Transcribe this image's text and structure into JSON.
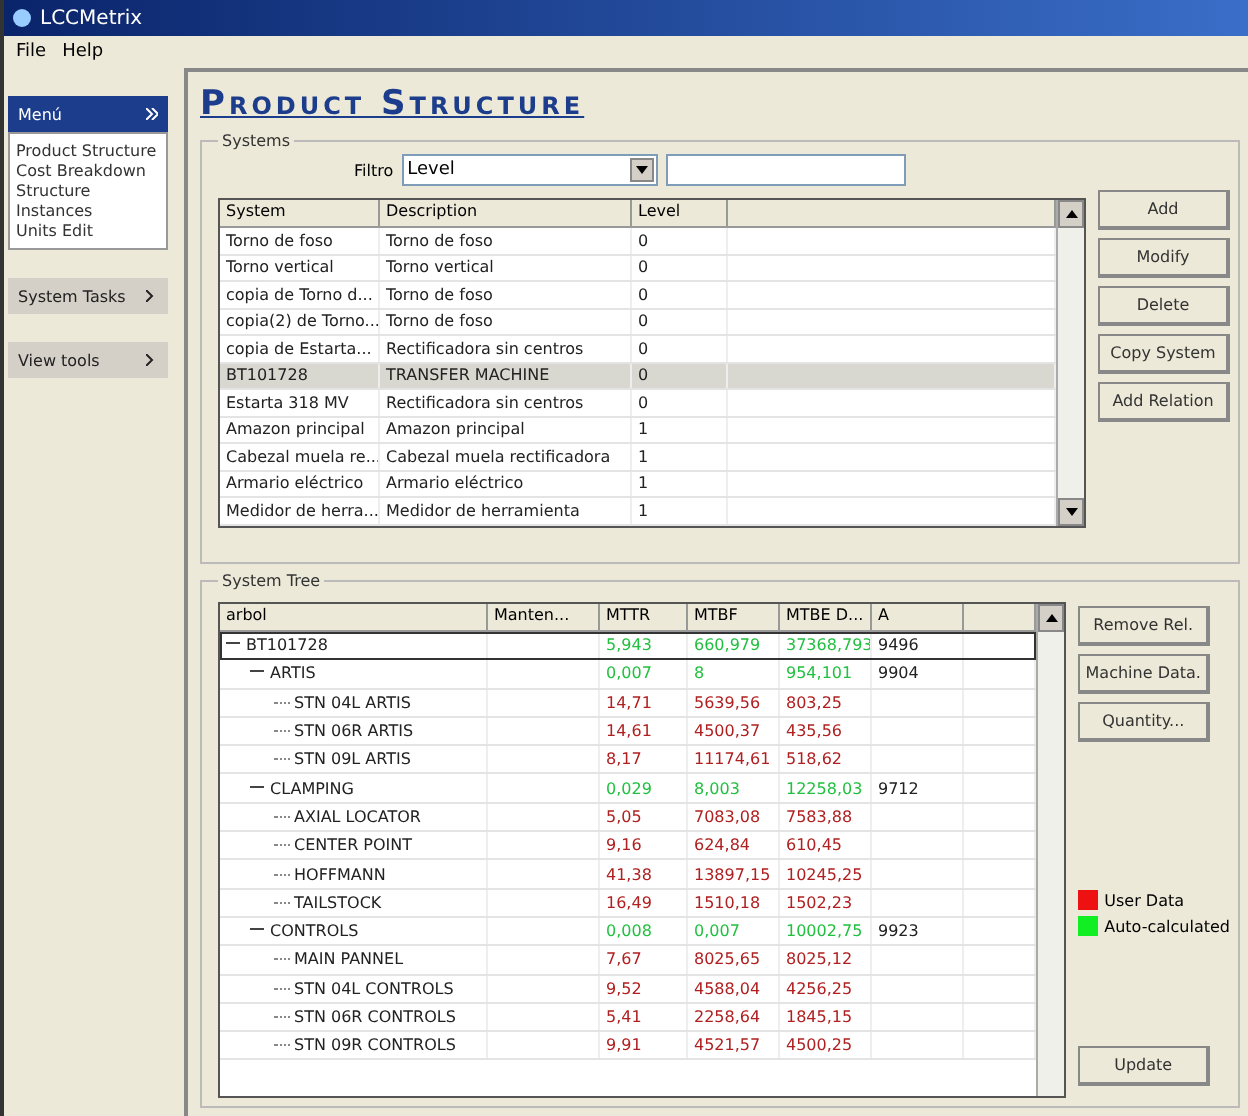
{
  "window": {
    "title": "LCCMetrix"
  },
  "menu": [
    "File",
    "Help"
  ],
  "sidebar": {
    "panels": [
      {
        "title": "Menú",
        "expanded": true,
        "items": [
          "Product Structure",
          "Cost Breakdown",
          "Structure",
          "Instances",
          "Units Edit"
        ]
      },
      {
        "title": "System Tasks",
        "expanded": false
      },
      {
        "title": "View tools",
        "expanded": false
      }
    ]
  },
  "page_title": "Product Structure",
  "systems": {
    "label": "Systems",
    "filter_label": "Filtro",
    "filter_value": "Level",
    "columns": [
      "System",
      "Description",
      "Level"
    ],
    "rows": [
      {
        "cells": [
          "Torno de foso",
          "Torno de foso",
          "0"
        ],
        "selected": false
      },
      {
        "cells": [
          "Torno vertical",
          "Torno vertical",
          "0"
        ],
        "selected": false
      },
      {
        "cells": [
          "copia de Torno d...",
          "Torno de foso",
          "0"
        ],
        "selected": false
      },
      {
        "cells": [
          "copia(2) de Torno...",
          "Torno de foso",
          "0"
        ],
        "selected": false
      },
      {
        "cells": [
          "copia de Estarta...",
          "Rectificadora sin centros",
          "0"
        ],
        "selected": false
      },
      {
        "cells": [
          "BT101728",
          "TRANSFER MACHINE",
          "0"
        ],
        "selected": true
      },
      {
        "cells": [
          "Estarta 318 MV",
          "Rectificadora sin centros",
          "0"
        ],
        "selected": false
      },
      {
        "cells": [
          "Amazon principal",
          "Amazon principal",
          "1"
        ],
        "selected": false
      },
      {
        "cells": [
          "Cabezal muela re...",
          "Cabezal muela rectificadora",
          "1"
        ],
        "selected": false
      },
      {
        "cells": [
          "Armario eléctrico",
          "Armario eléctrico",
          "1"
        ],
        "selected": false
      },
      {
        "cells": [
          "Medidor de herra...",
          "Medidor de herramienta",
          "1"
        ],
        "selected": false
      }
    ],
    "buttons": [
      "Add",
      "Modify",
      "Delete",
      "Copy System",
      "Add Relation"
    ]
  },
  "tree": {
    "label": "System Tree",
    "columns": [
      "arbol",
      "Manten...",
      "MTTR",
      "MTBF",
      "MTBE D...",
      "A"
    ],
    "nodes": [
      {
        "label": "BT101728",
        "values": [
          "5,943",
          "660,979",
          "37368,793"
        ],
        "a": "9496",
        "color": "#22c040",
        "selected": true,
        "expanded": true,
        "children": [
          {
            "label": "ARTIS",
            "values": [
              "0,007",
              "8",
              "954,101"
            ],
            "a": "9904",
            "color": "#22c040",
            "selected": false,
            "expanded": true,
            "children": [
              {
                "label": "STN 04L ARTIS",
                "values": [
                  "14,71",
                  "5639,56",
                  "803,25"
                ],
                "color": "#b02020",
                "selected": false
              },
              {
                "label": "STN 06R ARTIS",
                "values": [
                  "14,61",
                  "4500,37",
                  "435,56"
                ],
                "color": "#b02020",
                "selected": false
              },
              {
                "label": "STN 09L ARTIS",
                "values": [
                  "8,17",
                  "11174,61",
                  "518,62"
                ],
                "color": "#b02020",
                "selected": false
              }
            ]
          },
          {
            "label": "CLAMPING",
            "values": [
              "0,029",
              "8,003",
              "12258,03"
            ],
            "a": "9712",
            "color": "#22c040",
            "selected": false,
            "expanded": true,
            "children": [
              {
                "label": "AXIAL LOCATOR",
                "values": [
                  "5,05",
                  "7083,08",
                  "7583,88"
                ],
                "color": "#b02020",
                "selected": false
              },
              {
                "label": "CENTER POINT",
                "values": [
                  "9,16",
                  "624,84",
                  "610,45"
                ],
                "color": "#b02020",
                "selected": false
              },
              {
                "label": "HOFFMANN",
                "values": [
                  "41,38",
                  "13897,15",
                  "10245,25"
                ],
                "color": "#b02020",
                "selected": false
              },
              {
                "label": "TAILSTOCK",
                "values": [
                  "16,49",
                  "1510,18",
                  "1502,23"
                ],
                "color": "#b02020",
                "selected": false
              }
            ]
          },
          {
            "label": "CONTROLS",
            "values": [
              "0,008",
              "0,007",
              "10002,75"
            ],
            "a": "9923",
            "color": "#22c040",
            "selected": false,
            "expanded": true,
            "children": [
              {
                "label": "MAIN PANNEL",
                "values": [
                  "7,67",
                  "8025,65",
                  "8025,12"
                ],
                "color": "#b02020",
                "selected": false
              },
              {
                "label": "STN 04L CONTROLS",
                "values": [
                  "9,52",
                  "4588,04",
                  "4256,25"
                ],
                "color": "#b02020",
                "selected": false
              },
              {
                "label": "STN 06R CONTROLS",
                "values": [
                  "5,41",
                  "2258,64",
                  "1845,15"
                ],
                "color": "#b02020",
                "selected": false
              },
              {
                "label": "STN 09R CONTROLS",
                "values": [
                  "9,91",
                  "4521,57",
                  "4500,25"
                ],
                "color": "#b02020",
                "selected": false
              }
            ]
          }
        ]
      }
    ],
    "buttons": [
      "Remove Rel.",
      "Machine Data.",
      "Quantity..."
    ],
    "legend": [
      {
        "label": "User Data",
        "color": "#ee1111"
      },
      {
        "label": "Auto-calculated",
        "color": "#11ee22"
      }
    ],
    "update_button": "Update"
  }
}
